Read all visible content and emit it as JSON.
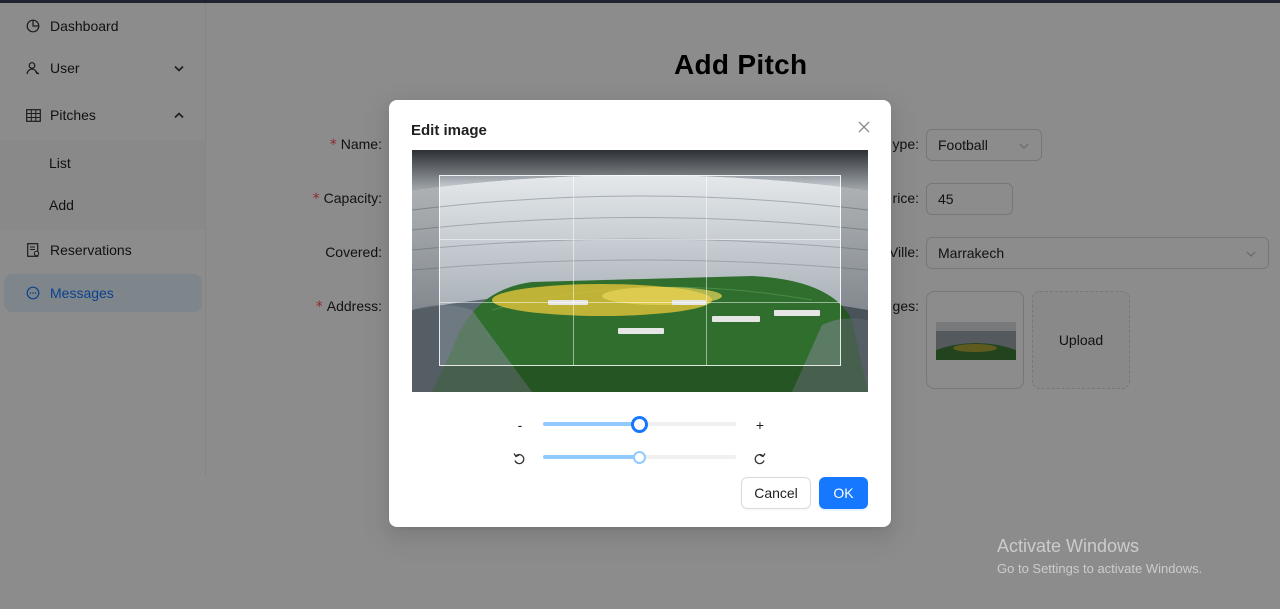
{
  "sidebar": {
    "items": [
      {
        "label": "Dashboard",
        "icon": "pie-chart-icon"
      },
      {
        "label": "User",
        "icon": "user-icon",
        "arrow": "chevron-down-icon"
      },
      {
        "label": "Pitches",
        "icon": "table-icon",
        "arrow": "chevron-up-icon"
      },
      {
        "label": "Reservations",
        "icon": "reservations-icon"
      },
      {
        "label": "Messages",
        "icon": "message-icon"
      }
    ],
    "pitches_sub": [
      {
        "label": "List"
      },
      {
        "label": "Add"
      }
    ]
  },
  "page": {
    "title": "Add Pitch"
  },
  "form": {
    "left_labels": {
      "name": "Name",
      "capacity": "Capacity",
      "covered": "Covered",
      "address": "Address"
    },
    "right_labels": {
      "type": "ype",
      "price": "rice",
      "ville": "Ville",
      "images": "ges"
    },
    "colon": ":",
    "required_mark": "*",
    "type_value": "Football",
    "price_value": "45",
    "ville_value": "Marrakech",
    "upload_label": "Upload"
  },
  "modal": {
    "title": "Edit image",
    "zoom_minus": "-",
    "zoom_plus": "+",
    "zoom_level": 0.5,
    "rotate_level": 0.5,
    "cancel_label": "Cancel",
    "ok_label": "OK"
  },
  "watermark": {
    "line1": "Activate Windows",
    "line2": "Go to Settings to activate Windows."
  },
  "colors": {
    "primary": "#1677ff",
    "slider_track": "#91caff",
    "required": "#ff4d4f",
    "active_bg": "#e6f4ff"
  }
}
